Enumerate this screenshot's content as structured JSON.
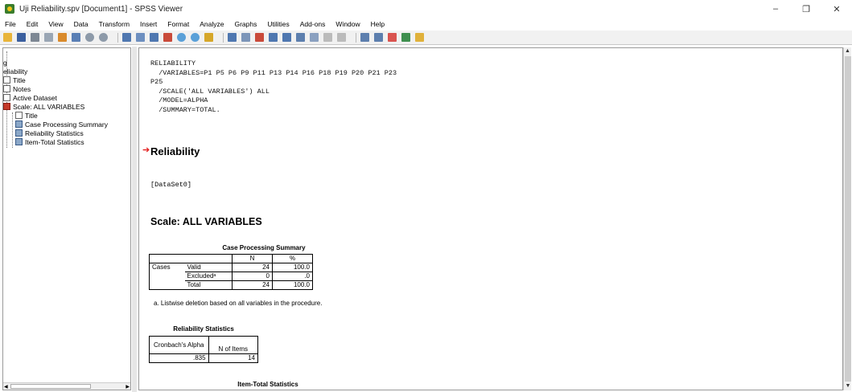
{
  "window": {
    "title": "Uji Reliability.spv [Document1] - SPSS Viewer",
    "controls": [
      "–",
      "❐",
      "✕"
    ]
  },
  "menu": [
    "File",
    "Edit",
    "View",
    "Data",
    "Transform",
    "Insert",
    "Format",
    "Analyze",
    "Graphs",
    "Utilities",
    "Add-ons",
    "Window",
    "Help"
  ],
  "outline": {
    "items": [
      {
        "label": "g",
        "icon": "log-icon"
      },
      {
        "label": "eliability",
        "icon": "book-icon"
      },
      {
        "label": "Title",
        "icon": "title-icon"
      },
      {
        "label": "Notes",
        "icon": "notes-icon"
      },
      {
        "label": "Active Dataset",
        "icon": "dataset-icon"
      },
      {
        "label": "Scale: ALL VARIABLES",
        "icon": "scale-icon"
      },
      {
        "label": "Title",
        "icon": "title-icon"
      },
      {
        "label": "Case Processing Summary",
        "icon": "table-icon"
      },
      {
        "label": "Reliability Statistics",
        "icon": "table-icon"
      },
      {
        "label": "Item-Total Statistics",
        "icon": "table-icon"
      }
    ]
  },
  "content": {
    "syntax": "RELIABILITY\n  /VARIABLES=P1 P5 P6 P9 P11 P13 P14 P16 P18 P19 P20 P21 P23\nP25\n  /SCALE('ALL VARIABLES') ALL\n  /MODEL=ALPHA\n  /SUMMARY=TOTAL.",
    "section_title": "Reliability",
    "dataset": "[DataSet0]",
    "scale_title": "Scale: ALL VARIABLES",
    "case_processing": {
      "caption": "Case Processing Summary",
      "headers": [
        "N",
        "%"
      ],
      "group_label": "Cases",
      "rows": [
        {
          "label": "Valid",
          "n": "24",
          "pct": "100.0"
        },
        {
          "label": "Excludedᵃ",
          "n": "0",
          "pct": ".0"
        },
        {
          "label": "Total",
          "n": "24",
          "pct": "100.0"
        }
      ],
      "footnote": "a. Listwise deletion based on all variables in the procedure."
    },
    "reliability_stats": {
      "caption": "Reliability Statistics",
      "header_alpha": "Cronbach's Alpha",
      "header_items": "N of Items",
      "alpha": ".835",
      "items": "14"
    },
    "item_total_caption": "Item-Total Statistics"
  },
  "colors": {
    "accent_arrow": "#e31b1b",
    "toolbar_bg": "#f1f1f1"
  }
}
